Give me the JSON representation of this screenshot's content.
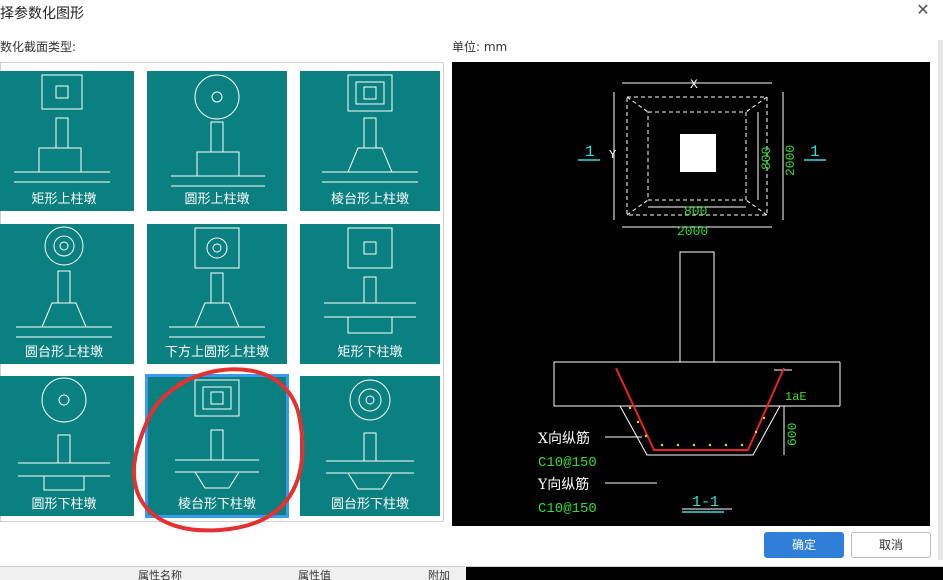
{
  "dialog": {
    "title": "择参数化图形"
  },
  "labels": {
    "section_type": "数化截面类型:",
    "unit": "单位:  mm"
  },
  "shapes": [
    {
      "name": "矩形上柱墩"
    },
    {
      "name": "圆形上柱墩"
    },
    {
      "name": "棱台形上柱墩"
    },
    {
      "name": "圆台形上柱墩"
    },
    {
      "name": "下方上圆形上柱墩"
    },
    {
      "name": "矩形下柱墩"
    },
    {
      "name": "圆形下柱墩"
    },
    {
      "name": "棱台形下柱墩"
    },
    {
      "name": "圆台形下柱墩"
    }
  ],
  "selected_index": 7,
  "preview": {
    "dim_x": "X",
    "dim_y": "Y",
    "dim_800_h": "800",
    "dim_2000_h": "2000",
    "dim_800_v": "800",
    "dim_2000_v": "2000",
    "section_mark_left": "1",
    "section_mark_right": "1",
    "lae": "1aE",
    "dim_600": "600",
    "x_rebar_label": "X向纵筋",
    "x_rebar_spec": "C10@150",
    "y_rebar_label": "Y向纵筋",
    "y_rebar_spec": "C10@150",
    "section_title": "1-1"
  },
  "buttons": {
    "ok": "确定",
    "cancel": "取消"
  },
  "bottom_bar": {
    "col1": "属性名称",
    "col2": "属性值",
    "col3": "附加"
  },
  "colors": {
    "tile": "#0a8080",
    "accent": "#2f7fd8",
    "dim_text": "#33dd33",
    "section_mark": "#33dddd",
    "rebar_red": "#ee2222"
  }
}
